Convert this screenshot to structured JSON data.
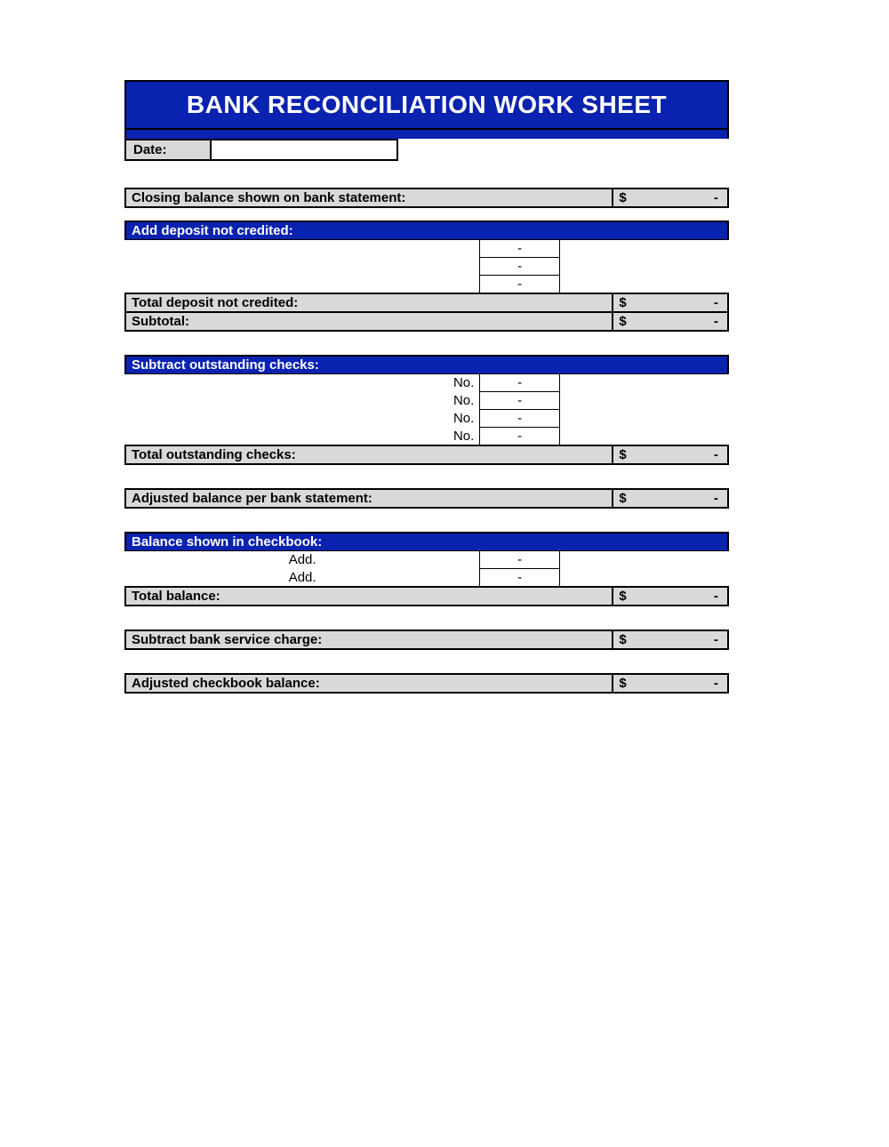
{
  "title": "BANK RECONCILIATION WORK SHEET",
  "date_label": "Date:",
  "date_value": "",
  "closing_balance_label": "Closing balance shown on bank statement:",
  "add_deposit_header": "Add deposit not credited:",
  "deposit_rows": [
    "-",
    "-",
    "-"
  ],
  "total_deposit_label": "Total deposit not credited:",
  "subtotal_label": "Subtotal:",
  "subtract_checks_header": "Subtract outstanding checks:",
  "check_row_label": "No.",
  "check_rows": [
    "-",
    "-",
    "-",
    "-"
  ],
  "total_checks_label": "Total outstanding checks:",
  "adjusted_bank_label": "Adjusted balance per bank statement:",
  "balance_checkbook_header": "Balance shown in checkbook:",
  "add_row_label": "Add.",
  "add_rows": [
    "-",
    "-"
  ],
  "total_balance_label": "Total balance:",
  "service_charge_label": "Subtract bank service charge:",
  "adjusted_checkbook_label": "Adjusted checkbook balance:",
  "currency": "$",
  "dash": "-"
}
